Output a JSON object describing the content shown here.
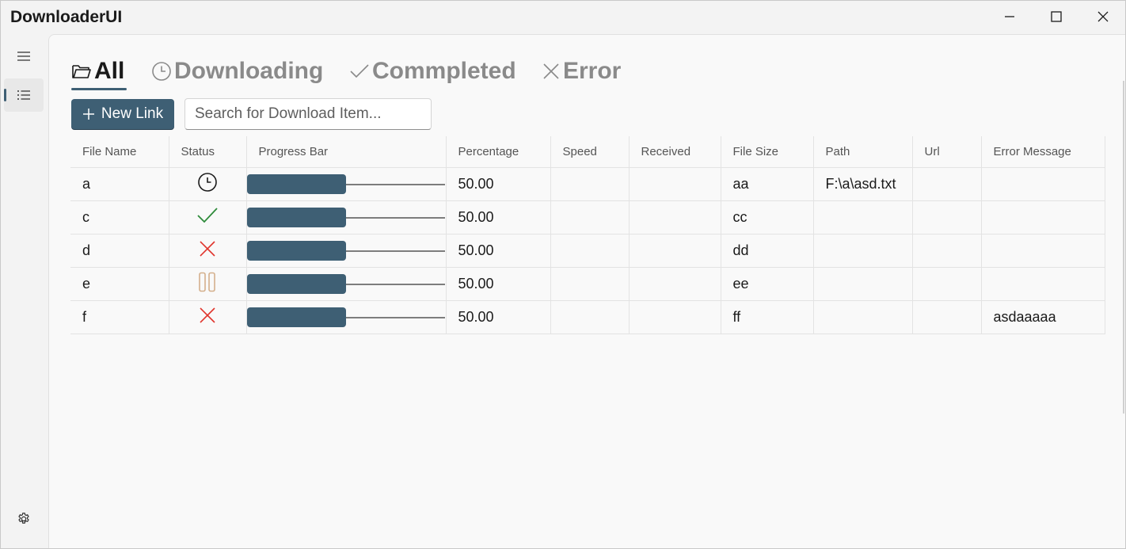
{
  "app": {
    "title": "DownloaderUI"
  },
  "tabs": [
    {
      "label": "All",
      "icon": "folder-icon",
      "active": true
    },
    {
      "label": "Downloading",
      "icon": "clock-icon",
      "active": false
    },
    {
      "label": "Commpleted",
      "icon": "checkmark-icon",
      "active": false
    },
    {
      "label": "Error",
      "icon": "close-icon",
      "active": false
    }
  ],
  "toolbar": {
    "new_link_label": "New Link",
    "search_placeholder": "Search for Download Item..."
  },
  "table": {
    "columns": [
      "File Name",
      "Status",
      "Progress Bar",
      "Percentage",
      "Speed",
      "Received",
      "File Size",
      "Path",
      "Url",
      "Error Message"
    ],
    "rows": [
      {
        "name": "a",
        "status": "downloading",
        "progress": 0.5,
        "percentage": "50.00",
        "speed": "",
        "received": "",
        "size": "aa",
        "path": "F:\\a\\asd.txt",
        "url": "",
        "error": ""
      },
      {
        "name": "c",
        "status": "completed",
        "progress": 0.5,
        "percentage": "50.00",
        "speed": "",
        "received": "",
        "size": "cc",
        "path": "",
        "url": "",
        "error": ""
      },
      {
        "name": "d",
        "status": "error",
        "progress": 0.5,
        "percentage": "50.00",
        "speed": "",
        "received": "",
        "size": "dd",
        "path": "",
        "url": "",
        "error": ""
      },
      {
        "name": "e",
        "status": "paused",
        "progress": 0.5,
        "percentage": "50.00",
        "speed": "",
        "received": "",
        "size": "ee",
        "path": "",
        "url": "",
        "error": ""
      },
      {
        "name": "f",
        "status": "error",
        "progress": 0.5,
        "percentage": "50.00",
        "speed": "",
        "received": "",
        "size": "ff",
        "path": "",
        "url": "",
        "error": "asdaaaaa"
      }
    ]
  },
  "colors": {
    "accent": "#3e5f74",
    "success": "#2e8b3a",
    "error": "#e0342c",
    "paused": "#d4b08c"
  }
}
